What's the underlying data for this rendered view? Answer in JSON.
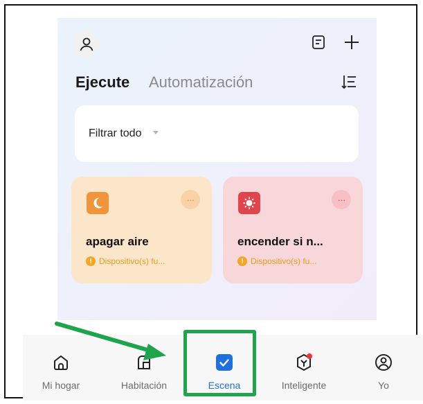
{
  "header": {
    "profile_icon": "user-icon",
    "notes_icon": "document-icon",
    "add_icon": "plus-icon",
    "sort_icon": "sort-icon"
  },
  "tabs": {
    "active": "Ejecute",
    "inactive": "Automatización"
  },
  "filter": {
    "label": "Filtrar todo"
  },
  "scenes": [
    {
      "name": "apagar aire",
      "status": "Dispositivo(s) fu...",
      "icon": "moon-icon",
      "color": "#f0953c"
    },
    {
      "name": "encender si n...",
      "status": "Dispositivo(s) fu...",
      "icon": "sun-icon",
      "color": "#e0454d"
    }
  ],
  "warning_glyph": "!",
  "more_glyph": "···",
  "nav": {
    "items": [
      {
        "label": "Mi hogar",
        "icon": "home-icon"
      },
      {
        "label": "Habitación",
        "icon": "room-icon"
      },
      {
        "label": "Escena",
        "icon": "check-icon"
      },
      {
        "label": "Inteligente",
        "icon": "smart-cube-icon"
      },
      {
        "label": "Yo",
        "icon": "profile-icon"
      }
    ],
    "active": "Escena"
  },
  "colors": {
    "highlight": "#1ea44a",
    "accent": "#1f6fdd",
    "notification_dot": "#e8363d"
  }
}
